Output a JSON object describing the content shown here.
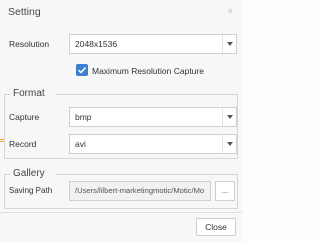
{
  "dialog": {
    "title": "Setting",
    "close_glyph": "×"
  },
  "resolution": {
    "label": "Resolution",
    "value": "2048x1536"
  },
  "max_capture": {
    "label": "Maximum Resolution Capture",
    "checked": true
  },
  "format": {
    "title": "Format",
    "capture": {
      "label": "Capture",
      "value": "bmp"
    },
    "record": {
      "label": "Record",
      "value": "avi"
    }
  },
  "gallery": {
    "title": "Gallery",
    "saving_path_label": "Saving Path",
    "saving_path_value": "/Users/lilbert-marketingmotic/Motic/Mo",
    "browse_label": "..."
  },
  "footer": {
    "close_label": "Close"
  },
  "colors": {
    "accent": "#3a7fd0",
    "left_marker": "#f0a830"
  }
}
